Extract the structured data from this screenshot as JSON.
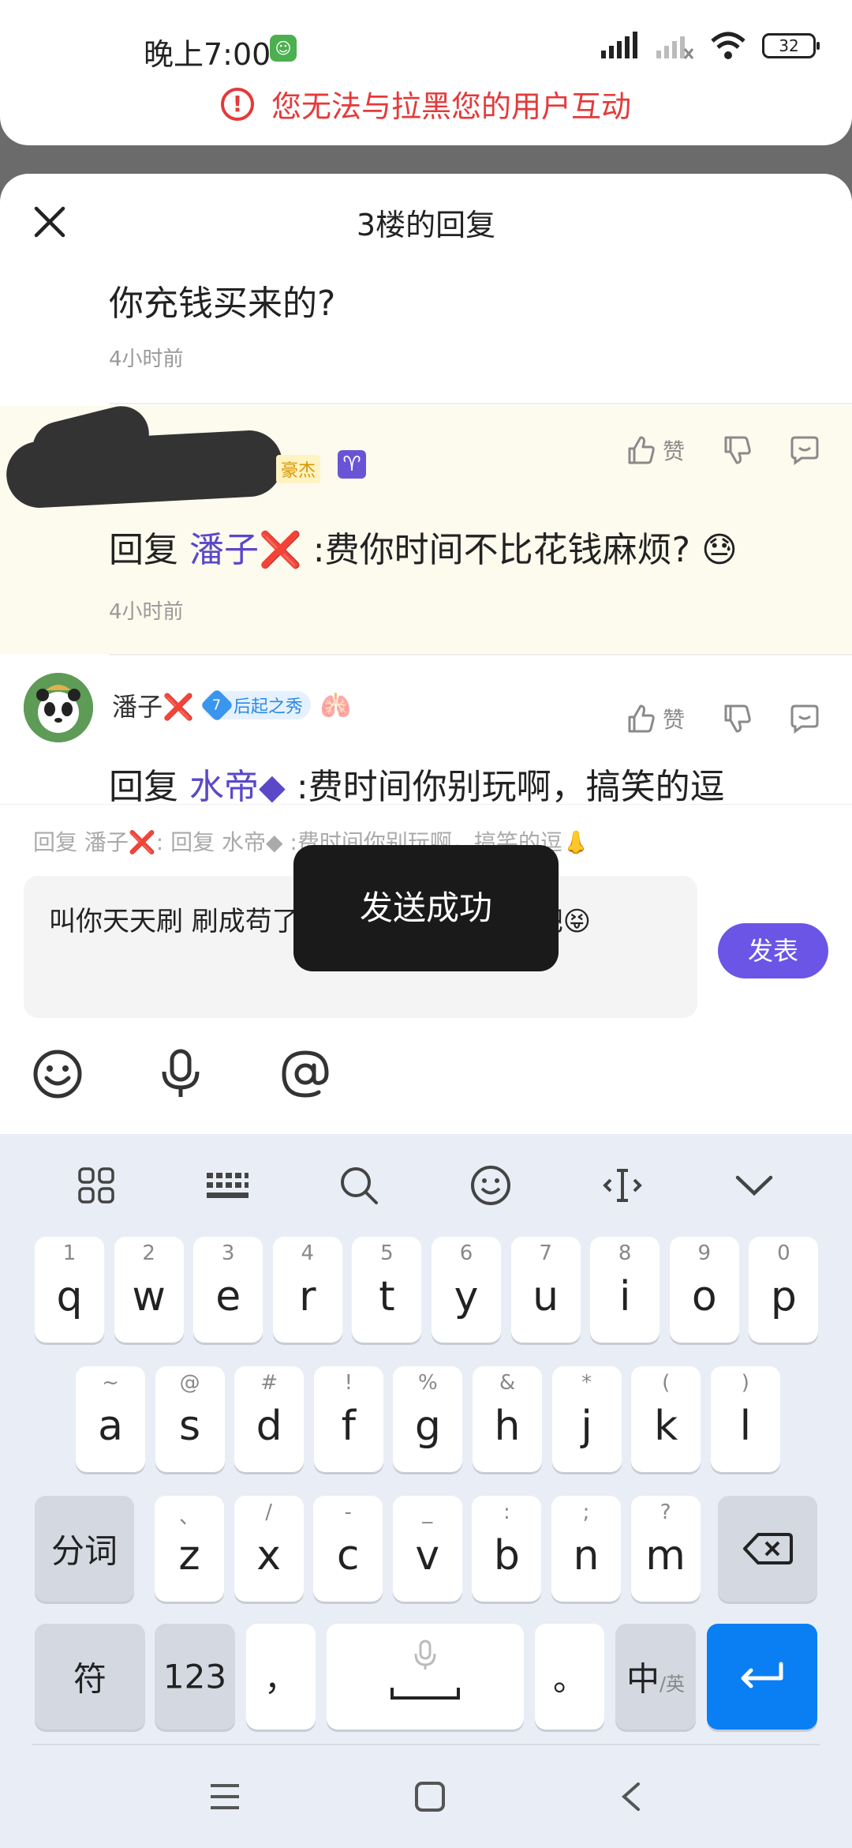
{
  "status_bar": {
    "time": "晚上7:00",
    "battery": "32"
  },
  "banner": {
    "message": "您无法与拉黑您的用户互动"
  },
  "sheet": {
    "title": "3楼的回复"
  },
  "replies": [
    {
      "text": "你充钱买来的?",
      "time": "4小时前"
    },
    {
      "badge": "豪杰",
      "prefix": "回复",
      "mention": "潘子❌",
      "body": " :费你时间不比花钱麻烦?",
      "emoji": "😓",
      "time": "4小时前"
    },
    {
      "username": "潘子❌",
      "level": "7",
      "level_title": "后起之秀",
      "extra_icon": "🫁",
      "prefix": "回复",
      "mention": "水帝◆",
      "body": " :费时间你别玩啊，搞笑的逗"
    }
  ],
  "actions": {
    "like_label": "赞"
  },
  "composer": {
    "quote": "回复 潘子❌: 回复 水帝◆ :费时间你别玩啊，搞笑的逗👃",
    "input_text": "叫你天天刷 刷成苟了? 没玩过正常的游戏吧😝",
    "send_label": "发表"
  },
  "toast": {
    "message": "发送成功"
  },
  "keyboard": {
    "row1": [
      {
        "h": "1",
        "k": "q"
      },
      {
        "h": "2",
        "k": "w"
      },
      {
        "h": "3",
        "k": "e"
      },
      {
        "h": "4",
        "k": "r"
      },
      {
        "h": "5",
        "k": "t"
      },
      {
        "h": "6",
        "k": "y"
      },
      {
        "h": "7",
        "k": "u"
      },
      {
        "h": "8",
        "k": "i"
      },
      {
        "h": "9",
        "k": "o"
      },
      {
        "h": "0",
        "k": "p"
      }
    ],
    "row2": [
      {
        "h": "~",
        "k": "a"
      },
      {
        "h": "@",
        "k": "s"
      },
      {
        "h": "#",
        "k": "d"
      },
      {
        "h": "!",
        "k": "f"
      },
      {
        "h": "%",
        "k": "g"
      },
      {
        "h": "&",
        "k": "h"
      },
      {
        "h": "*",
        "k": "j"
      },
      {
        "h": "(",
        "k": "k"
      },
      {
        "h": ")",
        "k": "l"
      }
    ],
    "row3": [
      {
        "h": "、",
        "k": "z"
      },
      {
        "h": "/",
        "k": "x"
      },
      {
        "h": "-",
        "k": "c"
      },
      {
        "h": "_",
        "k": "v"
      },
      {
        "h": ":",
        "k": "b"
      },
      {
        "h": ";",
        "k": "n"
      },
      {
        "h": "?",
        "k": "m"
      }
    ],
    "segment_label": "分词",
    "symbol_label": "符",
    "num_label": "123",
    "comma_label": "，",
    "period_label": "。",
    "lang_main": "中",
    "lang_alt": "/英"
  },
  "colors": {
    "accent": "#6b55e6",
    "warning": "#e5393a",
    "enter_key": "#0a7ef3"
  }
}
